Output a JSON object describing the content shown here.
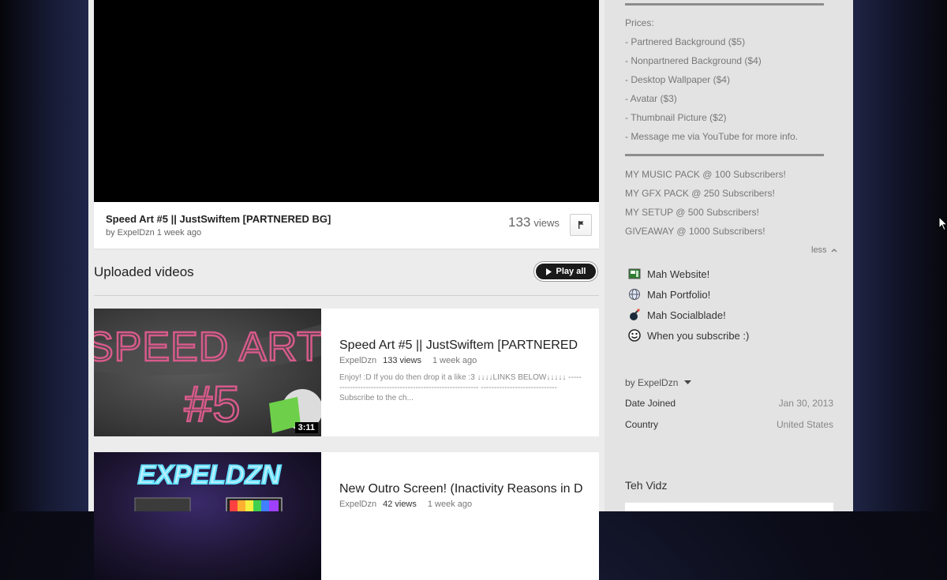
{
  "featured_video": {
    "title": "Speed Art #5 || JustSwiftem [PARTNERED BG]",
    "author_line": "by ExpelDzn 1 week ago",
    "views_count": "133",
    "views_label": "views"
  },
  "uploads": {
    "heading": "Uploaded videos",
    "play_all_label": "Play all",
    "videos": [
      {
        "thumb_text_line1": "SPEED ART",
        "thumb_text_line2": "#5",
        "duration": "3:11",
        "title": "Speed Art #5 || JustSwiftem [PARTNERED",
        "author": "ExpelDzn",
        "views": "133 views",
        "age": "1 week ago",
        "description": "Enjoy! :D If you do then drop it a like :3 ↓↓↓↓LINKS BELOW↓↓↓↓↓ ---------------------------------------------------------- ----------------------------- Subscribe to the ch..."
      },
      {
        "thumb_text_line1": "EXPELDZN",
        "title": "New Outro Screen! (Inactivity Reasons in D",
        "author": "ExpelDzn",
        "views": "42 views",
        "age": "1 week ago"
      }
    ]
  },
  "sidebar": {
    "prices_lines": [
      "Prices:",
      "- Partnered Background ($5)",
      "- Nonpartnered Background ($4)",
      "- Desktop Wallpaper ($4)",
      "- Avatar ($3)",
      "- Thumbnail Picture ($2)",
      "- Message me via YouTube for more info."
    ],
    "goal_lines": [
      "MY MUSIC PACK @ 100 Subscribers!",
      "MY GFX PACK @ 250 Subscribers!",
      "MY SETUP @ 500 Subscribers!",
      "GIVEAWAY @ 1000 Subscribers!"
    ],
    "less_label": "less",
    "links": [
      {
        "label": "Mah Website!",
        "icon": "website-icon"
      },
      {
        "label": "Mah Portfolio!",
        "icon": "globe-icon"
      },
      {
        "label": "Mah Socialblade!",
        "icon": "socialblade-icon"
      },
      {
        "label": "When you subscribe :)",
        "icon": "smiley-icon"
      }
    ],
    "by_label": "by ExpelDzn",
    "stats": {
      "date_joined_label": "Date Joined",
      "date_joined_value": "Jan 30, 2013",
      "country_label": "Country",
      "country_value": "United States"
    },
    "teh_vidz_heading": "Teh Vidz"
  },
  "colors": {
    "accent_dark": "#1a1a1a",
    "rule_gray": "#8d8d8d",
    "thumb_pink": "#d75a8a",
    "thumb_green": "#6ed04a",
    "thumb_cyan": "#63e2ff"
  }
}
